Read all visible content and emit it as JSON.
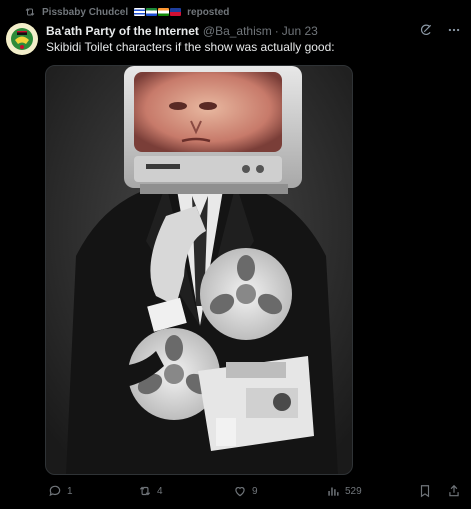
{
  "repost": {
    "user": "Pissbaby Chudcel",
    "suffix": "reposted",
    "icon": "repost-icon",
    "flags": [
      "flag-1",
      "flag-2",
      "flag-3",
      "flag-4"
    ]
  },
  "tweet": {
    "avatar_icon": "party-emblem-avatar",
    "display_name": "Ba'ath Party of the Internet",
    "handle": "@Ba_athism",
    "separator": "·",
    "time": "Jun 23",
    "text": "Skibidi Toilet characters if the show was actually good:",
    "media_description_icon": "tv-head-man-with-film-projector-image"
  },
  "actions": {
    "reply_count": "1",
    "repost_count": "4",
    "like_count": "9",
    "view_count": "529"
  },
  "colors": {
    "background": "#000000",
    "text_primary": "#e7e9ea",
    "text_secondary": "#71767b",
    "border": "#2f3336"
  }
}
